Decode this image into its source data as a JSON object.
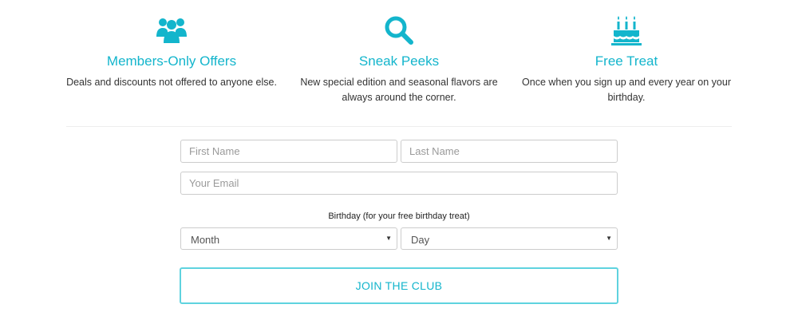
{
  "features": [
    {
      "icon": "members-icon",
      "title": "Members-Only Offers",
      "desc": "Deals and discounts not offered to anyone else."
    },
    {
      "icon": "search-icon",
      "title": "Sneak Peeks",
      "desc": "New special edition and seasonal flavors are always around the corner."
    },
    {
      "icon": "birthday-cake-icon",
      "title": "Free Treat",
      "desc": "Once when you sign up and every year on your birthday."
    }
  ],
  "colors": {
    "accent": "#13b5cc",
    "button_border": "#5fd3df",
    "input_border": "#cccccc"
  },
  "form": {
    "first_name_placeholder": "First Name",
    "last_name_placeholder": "Last Name",
    "email_placeholder": "Your Email",
    "birthday_label": "Birthday (for your free birthday treat)",
    "month_value": "Month",
    "day_value": "Day",
    "submit_label": "JOIN THE CLUB"
  }
}
